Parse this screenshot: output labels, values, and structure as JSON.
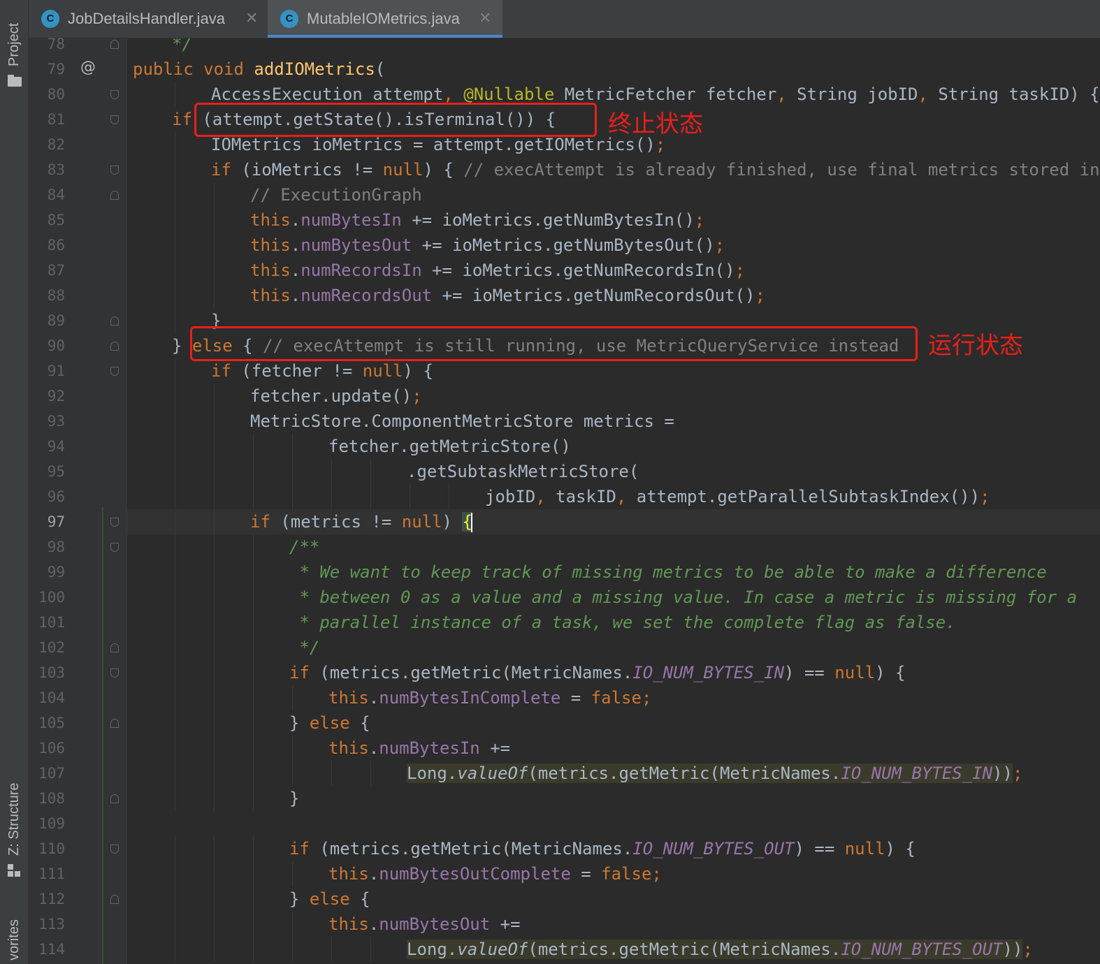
{
  "sidebar": {
    "project_label": "Project",
    "structure_label": "Z: Structure",
    "favorites_label": "vorites"
  },
  "tabs": [
    {
      "label": "JobDetailsHandler.java",
      "icon": "class-icon",
      "icon_letter": "C",
      "close": "✕",
      "active": false
    },
    {
      "label": "MutableIOMetrics.java",
      "icon": "class-icon",
      "icon_letter": "C",
      "close": "✕",
      "active": true
    }
  ],
  "gutter": {
    "override_marker": "@",
    "current_line": 97
  },
  "annotations": {
    "terminal_state": "终止状态",
    "running_state": "运行状态"
  },
  "colors": {
    "keyword": "#cc7832",
    "field": "#9876aa",
    "method": "#ffc66d",
    "comment": "#808080",
    "javadoc": "#629755",
    "annotation_box": "#e8201a",
    "tab_underline": "#4a88c7"
  },
  "code_lines": [
    {
      "n": "78",
      "indent": 2,
      "tokens": [
        [
          "doc",
          "*/"
        ]
      ]
    },
    {
      "n": "79",
      "indent": 1,
      "tokens": [
        [
          "kw",
          "public void "
        ],
        [
          "mth",
          "addIOMetrics"
        ],
        [
          "",
          "("
        ]
      ]
    },
    {
      "n": "80",
      "indent": 3,
      "tokens": [
        [
          "",
          "AccessExecution attempt"
        ],
        [
          "kw",
          ", "
        ],
        [
          "ann",
          "@Nullable "
        ],
        [
          "",
          "MetricFetcher fetcher"
        ],
        [
          "kw",
          ", "
        ],
        [
          "",
          "String jobID"
        ],
        [
          "kw",
          ", "
        ],
        [
          "",
          "String taskID) {"
        ]
      ]
    },
    {
      "n": "81",
      "indent": 2,
      "tokens": [
        [
          "kw",
          "if "
        ],
        [
          "",
          "(attempt.getState().isTerminal()) {"
        ]
      ]
    },
    {
      "n": "82",
      "indent": 3,
      "tokens": [
        [
          "",
          "IOMetrics ioMetrics = attempt.getIOMetrics()"
        ],
        [
          "kw",
          ";"
        ]
      ]
    },
    {
      "n": "83",
      "indent": 3,
      "tokens": [
        [
          "kw",
          "if "
        ],
        [
          "",
          "(ioMetrics != "
        ],
        [
          "kw",
          "null"
        ],
        [
          "",
          ") { "
        ],
        [
          "cmt",
          "// execAttempt is already finished, use final metrics stored in"
        ]
      ]
    },
    {
      "n": "84",
      "indent": 4,
      "tokens": [
        [
          "cmt",
          "// ExecutionGraph"
        ]
      ]
    },
    {
      "n": "85",
      "indent": 4,
      "tokens": [
        [
          "kw",
          "this"
        ],
        [
          "",
          "."
        ],
        [
          "fld",
          "numBytesIn "
        ],
        [
          "",
          "+= ioMetrics.getNumBytesIn()"
        ],
        [
          "kw",
          ";"
        ]
      ]
    },
    {
      "n": "86",
      "indent": 4,
      "tokens": [
        [
          "kw",
          "this"
        ],
        [
          "",
          "."
        ],
        [
          "fld",
          "numBytesOut "
        ],
        [
          "",
          "+= ioMetrics.getNumBytesOut()"
        ],
        [
          "kw",
          ";"
        ]
      ]
    },
    {
      "n": "87",
      "indent": 4,
      "tokens": [
        [
          "kw",
          "this"
        ],
        [
          "",
          "."
        ],
        [
          "fld",
          "numRecordsIn "
        ],
        [
          "",
          "+= ioMetrics.getNumRecordsIn()"
        ],
        [
          "kw",
          ";"
        ]
      ]
    },
    {
      "n": "88",
      "indent": 4,
      "tokens": [
        [
          "kw",
          "this"
        ],
        [
          "",
          "."
        ],
        [
          "fld",
          "numRecordsOut "
        ],
        [
          "",
          "+= ioMetrics.getNumRecordsOut()"
        ],
        [
          "kw",
          ";"
        ]
      ]
    },
    {
      "n": "89",
      "indent": 3,
      "tokens": [
        [
          "",
          "}"
        ]
      ]
    },
    {
      "n": "90",
      "indent": 2,
      "tokens": [
        [
          "",
          "} "
        ],
        [
          "kw",
          "else "
        ],
        [
          "",
          "{ "
        ],
        [
          "cmt",
          "// execAttempt is still running, use MetricQueryService instead"
        ]
      ]
    },
    {
      "n": "91",
      "indent": 3,
      "tokens": [
        [
          "kw",
          "if "
        ],
        [
          "",
          "(fetcher != "
        ],
        [
          "kw",
          "null"
        ],
        [
          "",
          ") {"
        ]
      ]
    },
    {
      "n": "92",
      "indent": 4,
      "tokens": [
        [
          "",
          "fetcher.update()"
        ],
        [
          "kw",
          ";"
        ]
      ]
    },
    {
      "n": "93",
      "indent": 4,
      "tokens": [
        [
          "",
          "MetricStore.ComponentMetricStore metrics ="
        ]
      ]
    },
    {
      "n": "94",
      "indent": 6,
      "tokens": [
        [
          "",
          "fetcher.getMetricStore()"
        ]
      ]
    },
    {
      "n": "95",
      "indent": 8,
      "tokens": [
        [
          "",
          ".getSubtaskMetricStore("
        ]
      ]
    },
    {
      "n": "96",
      "indent": 10,
      "tokens": [
        [
          "",
          "jobID"
        ],
        [
          "kw",
          ", "
        ],
        [
          "",
          "taskID"
        ],
        [
          "kw",
          ", "
        ],
        [
          "",
          "attempt.getParallelSubtaskIndex())"
        ],
        [
          "kw",
          ";"
        ]
      ]
    },
    {
      "n": "97",
      "indent": 4,
      "tokens": [
        [
          "kw",
          "if "
        ],
        [
          "",
          "(metrics != "
        ],
        [
          "kw",
          "null"
        ],
        [
          "",
          ") "
        ],
        [
          "brace",
          "{"
        ]
      ]
    },
    {
      "n": "98",
      "indent": 5,
      "tokens": [
        [
          "doc",
          "/**"
        ]
      ]
    },
    {
      "n": "99",
      "indent": 5,
      "tokens": [
        [
          "doc",
          " * We want to keep track of missing metrics to be able to make a difference"
        ]
      ]
    },
    {
      "n": "100",
      "indent": 5,
      "tokens": [
        [
          "doc",
          " * between 0 as a value and a missing value. In case a metric is missing for a"
        ]
      ]
    },
    {
      "n": "101",
      "indent": 5,
      "tokens": [
        [
          "doc",
          " * parallel instance of a task, we set the complete flag as false."
        ]
      ]
    },
    {
      "n": "102",
      "indent": 5,
      "tokens": [
        [
          "doc",
          " */"
        ]
      ]
    },
    {
      "n": "103",
      "indent": 5,
      "tokens": [
        [
          "kw",
          "if "
        ],
        [
          "",
          "(metrics.getMetric(MetricNames."
        ],
        [
          "cst",
          "IO_NUM_BYTES_IN"
        ],
        [
          "",
          ") == "
        ],
        [
          "kw",
          "null"
        ],
        [
          "",
          ") {"
        ]
      ]
    },
    {
      "n": "104",
      "indent": 6,
      "tokens": [
        [
          "kw",
          "this"
        ],
        [
          "",
          "."
        ],
        [
          "fld",
          "numBytesInComplete "
        ],
        [
          "",
          "= "
        ],
        [
          "kw",
          "false;"
        ]
      ]
    },
    {
      "n": "105",
      "indent": 5,
      "tokens": [
        [
          "",
          "} "
        ],
        [
          "kw",
          "else "
        ],
        [
          "",
          "{"
        ]
      ]
    },
    {
      "n": "106",
      "indent": 6,
      "tokens": [
        [
          "kw",
          "this"
        ],
        [
          "",
          "."
        ],
        [
          "fld",
          "numBytesIn "
        ],
        [
          "",
          "+="
        ]
      ]
    },
    {
      "n": "107",
      "indent": 8,
      "tokens": [
        [
          "hl",
          "Long."
        ],
        [
          "hlm",
          "valueOf"
        ],
        [
          "hl",
          "(metrics.getMetric(MetricNames."
        ],
        [
          "hlc",
          "IO_NUM_BYTES_IN"
        ],
        [
          "hl",
          "))"
        ],
        [
          "kw",
          ";"
        ]
      ]
    },
    {
      "n": "108",
      "indent": 5,
      "tokens": [
        [
          "",
          "}"
        ]
      ]
    },
    {
      "n": "109",
      "indent": 0,
      "tokens": []
    },
    {
      "n": "110",
      "indent": 5,
      "tokens": [
        [
          "kw",
          "if "
        ],
        [
          "",
          "(metrics.getMetric(MetricNames."
        ],
        [
          "cst",
          "IO_NUM_BYTES_OUT"
        ],
        [
          "",
          ") == "
        ],
        [
          "kw",
          "null"
        ],
        [
          "",
          ") {"
        ]
      ]
    },
    {
      "n": "111",
      "indent": 6,
      "tokens": [
        [
          "kw",
          "this"
        ],
        [
          "",
          "."
        ],
        [
          "fld",
          "numBytesOutComplete "
        ],
        [
          "",
          "= "
        ],
        [
          "kw",
          "false;"
        ]
      ]
    },
    {
      "n": "112",
      "indent": 5,
      "tokens": [
        [
          "",
          "} "
        ],
        [
          "kw",
          "else "
        ],
        [
          "",
          "{"
        ]
      ]
    },
    {
      "n": "113",
      "indent": 6,
      "tokens": [
        [
          "kw",
          "this"
        ],
        [
          "",
          "."
        ],
        [
          "fld",
          "numBytesOut "
        ],
        [
          "",
          "+="
        ]
      ]
    },
    {
      "n": "114",
      "indent": 8,
      "tokens": [
        [
          "hl",
          "Long."
        ],
        [
          "hlm",
          "valueOf"
        ],
        [
          "hl",
          "(metrics.getMetric(MetricNames."
        ],
        [
          "hlc",
          "IO_NUM_BYTES_OUT"
        ],
        [
          "hl",
          "))"
        ],
        [
          "kw",
          ";"
        ]
      ]
    }
  ]
}
